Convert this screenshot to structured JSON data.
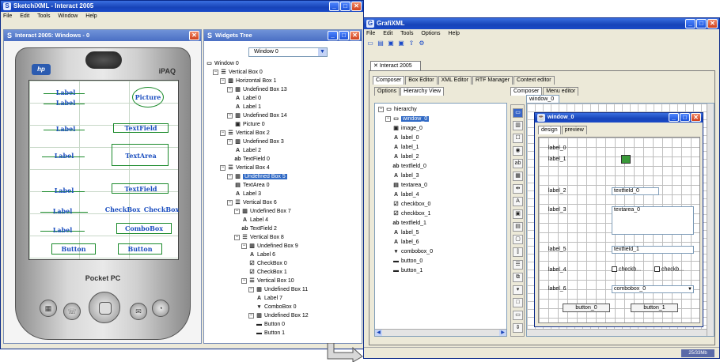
{
  "sketchi": {
    "title": "SketchiXML - Interact 2005",
    "menu": [
      "File",
      "Edit",
      "Tools",
      "Window",
      "Help"
    ],
    "left_subwindow_title": "Interact 2005: Windows - 0",
    "right_subwindow_title": "Widgets Tree",
    "pda": {
      "brand": "iPAQ",
      "logo": "hp",
      "model": "Pocket PC"
    },
    "sketch_labels": {
      "label_1": "Label",
      "label_2": "Label",
      "label_3": "Label",
      "label_4": "Label",
      "label_5": "Label",
      "label_6": "Label",
      "label_7": "Label",
      "picture": "Picture",
      "textfield_1": "TextField",
      "textarea": "TextArea",
      "textfield_2": "TextField",
      "checkbox_1": "CheckBox",
      "checkbox_2": "CheckBox",
      "combobox": "ComboBox",
      "button_1": "Button",
      "button_2": "Button"
    },
    "widgets_tree": {
      "selector_value": "Window 0",
      "nodes": [
        {
          "text": "Window 0",
          "depth": 0,
          "icon": "window",
          "expander": ""
        },
        {
          "text": "Vertical Box 0",
          "depth": 1,
          "icon": "vbox",
          "expander": "-"
        },
        {
          "text": "Horizontal Box 1",
          "depth": 2,
          "icon": "hbox",
          "expander": "-"
        },
        {
          "text": "Undefined Box 13",
          "depth": 3,
          "icon": "hbox",
          "expander": "-"
        },
        {
          "text": "Label 0",
          "depth": 4,
          "icon": "A",
          "expander": ""
        },
        {
          "text": "Label 1",
          "depth": 4,
          "icon": "A",
          "expander": ""
        },
        {
          "text": "Undefined Box 14",
          "depth": 3,
          "icon": "hbox",
          "expander": "-"
        },
        {
          "text": "Picture 0",
          "depth": 4,
          "icon": "picture",
          "expander": ""
        },
        {
          "text": "Vertical Box 2",
          "depth": 2,
          "icon": "vbox",
          "expander": "-"
        },
        {
          "text": "Undefined Box 3",
          "depth": 3,
          "icon": "hbox",
          "expander": "-"
        },
        {
          "text": "Label 2",
          "depth": 4,
          "icon": "A",
          "expander": ""
        },
        {
          "text": "TextField 0",
          "depth": 4,
          "icon": "abl",
          "expander": ""
        },
        {
          "text": "Vertical Box 4",
          "depth": 2,
          "icon": "vbox",
          "expander": "-"
        },
        {
          "text": "Undefined Box 5",
          "depth": 3,
          "icon": "hbox",
          "expander": "-",
          "selected": true
        },
        {
          "text": "TextArea 0",
          "depth": 4,
          "icon": "textarea",
          "expander": ""
        },
        {
          "text": "Label 3",
          "depth": 4,
          "icon": "A",
          "expander": ""
        },
        {
          "text": "Vertical Box 6",
          "depth": 3,
          "icon": "vbox",
          "expander": "-"
        },
        {
          "text": "Undefined Box 7",
          "depth": 4,
          "icon": "hbox",
          "expander": "-"
        },
        {
          "text": "Label 4",
          "depth": 5,
          "icon": "A",
          "expander": ""
        },
        {
          "text": "TextField 2",
          "depth": 5,
          "icon": "abl",
          "expander": ""
        },
        {
          "text": "Vertical Box 8",
          "depth": 4,
          "icon": "vbox",
          "expander": "-"
        },
        {
          "text": "Undefined Box 9",
          "depth": 5,
          "icon": "hbox",
          "expander": "-"
        },
        {
          "text": "Label 6",
          "depth": 6,
          "icon": "A",
          "expander": ""
        },
        {
          "text": "CheckBox 0",
          "depth": 6,
          "icon": "check",
          "expander": ""
        },
        {
          "text": "CheckBox 1",
          "depth": 6,
          "icon": "check",
          "expander": ""
        },
        {
          "text": "Vertical Box 10",
          "depth": 5,
          "icon": "vbox",
          "expander": "-"
        },
        {
          "text": "Undefined Box 11",
          "depth": 6,
          "icon": "hbox",
          "expander": "-"
        },
        {
          "text": "Label 7",
          "depth": 7,
          "icon": "A",
          "expander": ""
        },
        {
          "text": "ComboBox 0",
          "depth": 7,
          "icon": "combo",
          "expander": ""
        },
        {
          "text": "Undefined Box 12",
          "depth": 6,
          "icon": "hbox",
          "expander": "-"
        },
        {
          "text": "Button 0",
          "depth": 7,
          "icon": "button",
          "expander": ""
        },
        {
          "text": "Button 1",
          "depth": 7,
          "icon": "button",
          "expander": ""
        }
      ]
    }
  },
  "grafi": {
    "title": "GrafiXML",
    "menu": [
      "File",
      "Edit",
      "Tools",
      "Options",
      "Help"
    ],
    "document_tab": "Interact 2005",
    "main_tabs": [
      "Composer",
      "Box Editor",
      "XML Editor",
      "RTF Manager",
      "Context editor"
    ],
    "left_tabs": [
      "Options",
      "Hierarchy View"
    ],
    "right_tabs": [
      "Composer",
      "Menu editor"
    ],
    "canvas_tab": "window_0",
    "hierarchy": [
      {
        "text": "hierarchy",
        "depth": 0,
        "icon": "folder"
      },
      {
        "text": "window_0",
        "depth": 1,
        "icon": "window",
        "selected": true
      },
      {
        "text": "image_0",
        "depth": 2,
        "icon": "picture"
      },
      {
        "text": "label_0",
        "depth": 2,
        "icon": "A"
      },
      {
        "text": "label_1",
        "depth": 2,
        "icon": "A"
      },
      {
        "text": "label_2",
        "depth": 2,
        "icon": "A"
      },
      {
        "text": "textfield_0",
        "depth": 2,
        "icon": "abl"
      },
      {
        "text": "label_3",
        "depth": 2,
        "icon": "A"
      },
      {
        "text": "textarea_0",
        "depth": 2,
        "icon": "textarea"
      },
      {
        "text": "label_4",
        "depth": 2,
        "icon": "A"
      },
      {
        "text": "checkbox_0",
        "depth": 2,
        "icon": "check"
      },
      {
        "text": "checkbox_1",
        "depth": 2,
        "icon": "check"
      },
      {
        "text": "textfield_1",
        "depth": 2,
        "icon": "abl"
      },
      {
        "text": "label_5",
        "depth": 2,
        "icon": "A"
      },
      {
        "text": "label_6",
        "depth": 2,
        "icon": "A"
      },
      {
        "text": "combobox_0",
        "depth": 2,
        "icon": "combo"
      },
      {
        "text": "button_0",
        "depth": 2,
        "icon": "button"
      },
      {
        "text": "button_1",
        "depth": 2,
        "icon": "button"
      }
    ],
    "palette_icons": [
      "pointer-icon",
      "hbox-icon",
      "vbox-icon",
      "radio-icon",
      "textfield-icon",
      "grid-icon",
      "separator-icon",
      "label-icon",
      "picture-icon",
      "table-icon",
      "panel-icon",
      "split-icon",
      "list-icon",
      "tree-icon",
      "combo-icon",
      "frame-icon",
      "dialog-icon",
      "scroll-icon"
    ],
    "inner_window": {
      "title": "window_0",
      "tabs": [
        "design",
        "preview"
      ],
      "label_0": "label_0",
      "label_1": "label_1",
      "label_2": "label_2",
      "textfield_0": "textfield_0",
      "label_3": "label_3",
      "textarea_0": "textarea_0",
      "label_5": "label_5",
      "textfield_1": "textfield_1",
      "label_4": "label_4",
      "checkbox_0": "checkb...",
      "checkbox_1": "checkb...",
      "label_6": "label_6",
      "combobox_0": "combobox_0",
      "button_0": "button_0",
      "button_1": "button_1"
    },
    "status_memory": "25/33Mb"
  },
  "colors": {
    "titlebar": "#1743b8",
    "sketch_pen": "#1a4dbf",
    "sketch_box": "#1a8a2a",
    "selection": "#316ac5"
  }
}
